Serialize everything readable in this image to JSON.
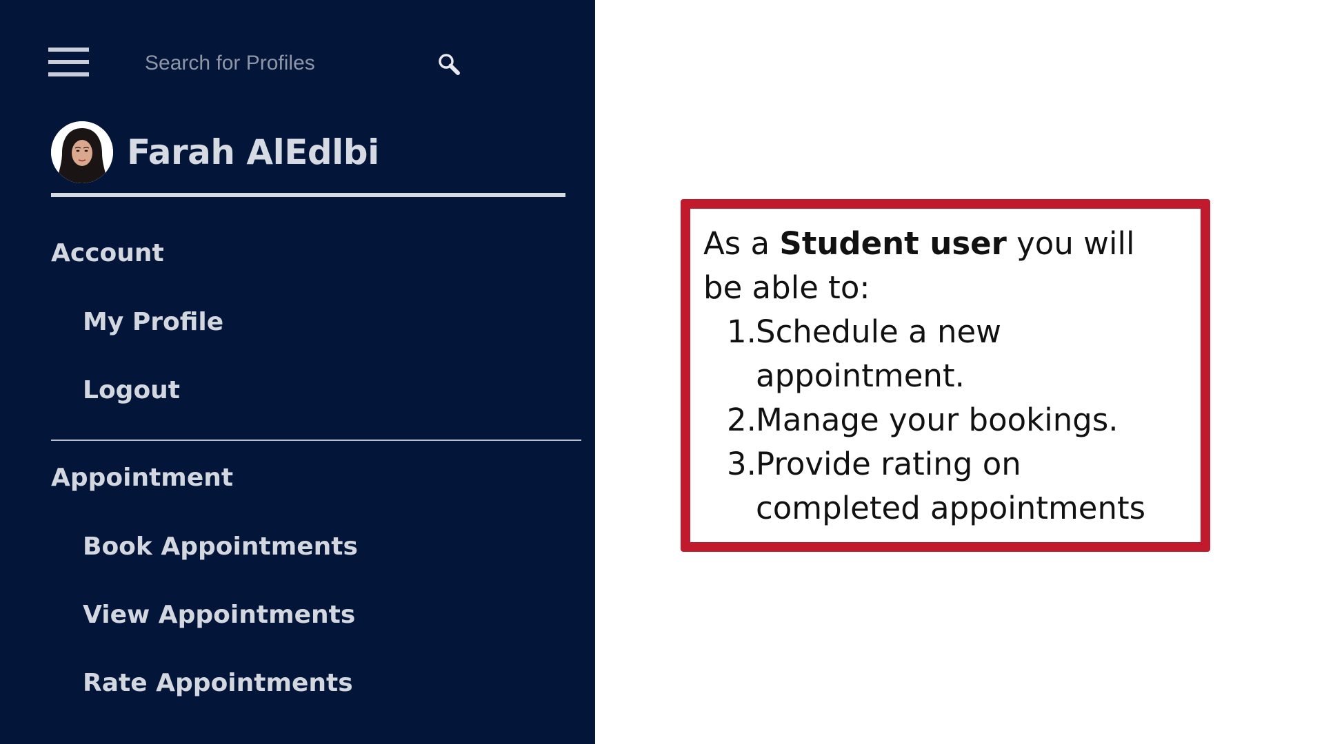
{
  "search": {
    "placeholder": "Search for Profiles"
  },
  "user": {
    "name": "Farah AlEdlbi"
  },
  "sidebar": {
    "sections": [
      {
        "heading": "Account",
        "items": [
          "My Profile",
          "Logout"
        ]
      },
      {
        "heading": "Appointment",
        "items": [
          "Book Appointments",
          "View Appointments",
          "Rate Appointments"
        ]
      }
    ]
  },
  "info": {
    "intro_prefix": "As a ",
    "intro_bold": "Student user",
    "intro_suffix": " you will be able to:",
    "steps": [
      {
        "number": "1.",
        "text": "Schedule a new appointment."
      },
      {
        "number": "2.",
        "text": "Manage your bookings."
      },
      {
        "number": "3.",
        "text": "Provide rating on completed appointments"
      }
    ]
  },
  "colors": {
    "sidebar_bg": "#03163a",
    "sidebar_text": "#d3d7df",
    "box_border": "#c01a2c"
  },
  "icons": {
    "menu": "hamburger-menu-icon",
    "search": "search-icon",
    "avatar": "avatar"
  }
}
